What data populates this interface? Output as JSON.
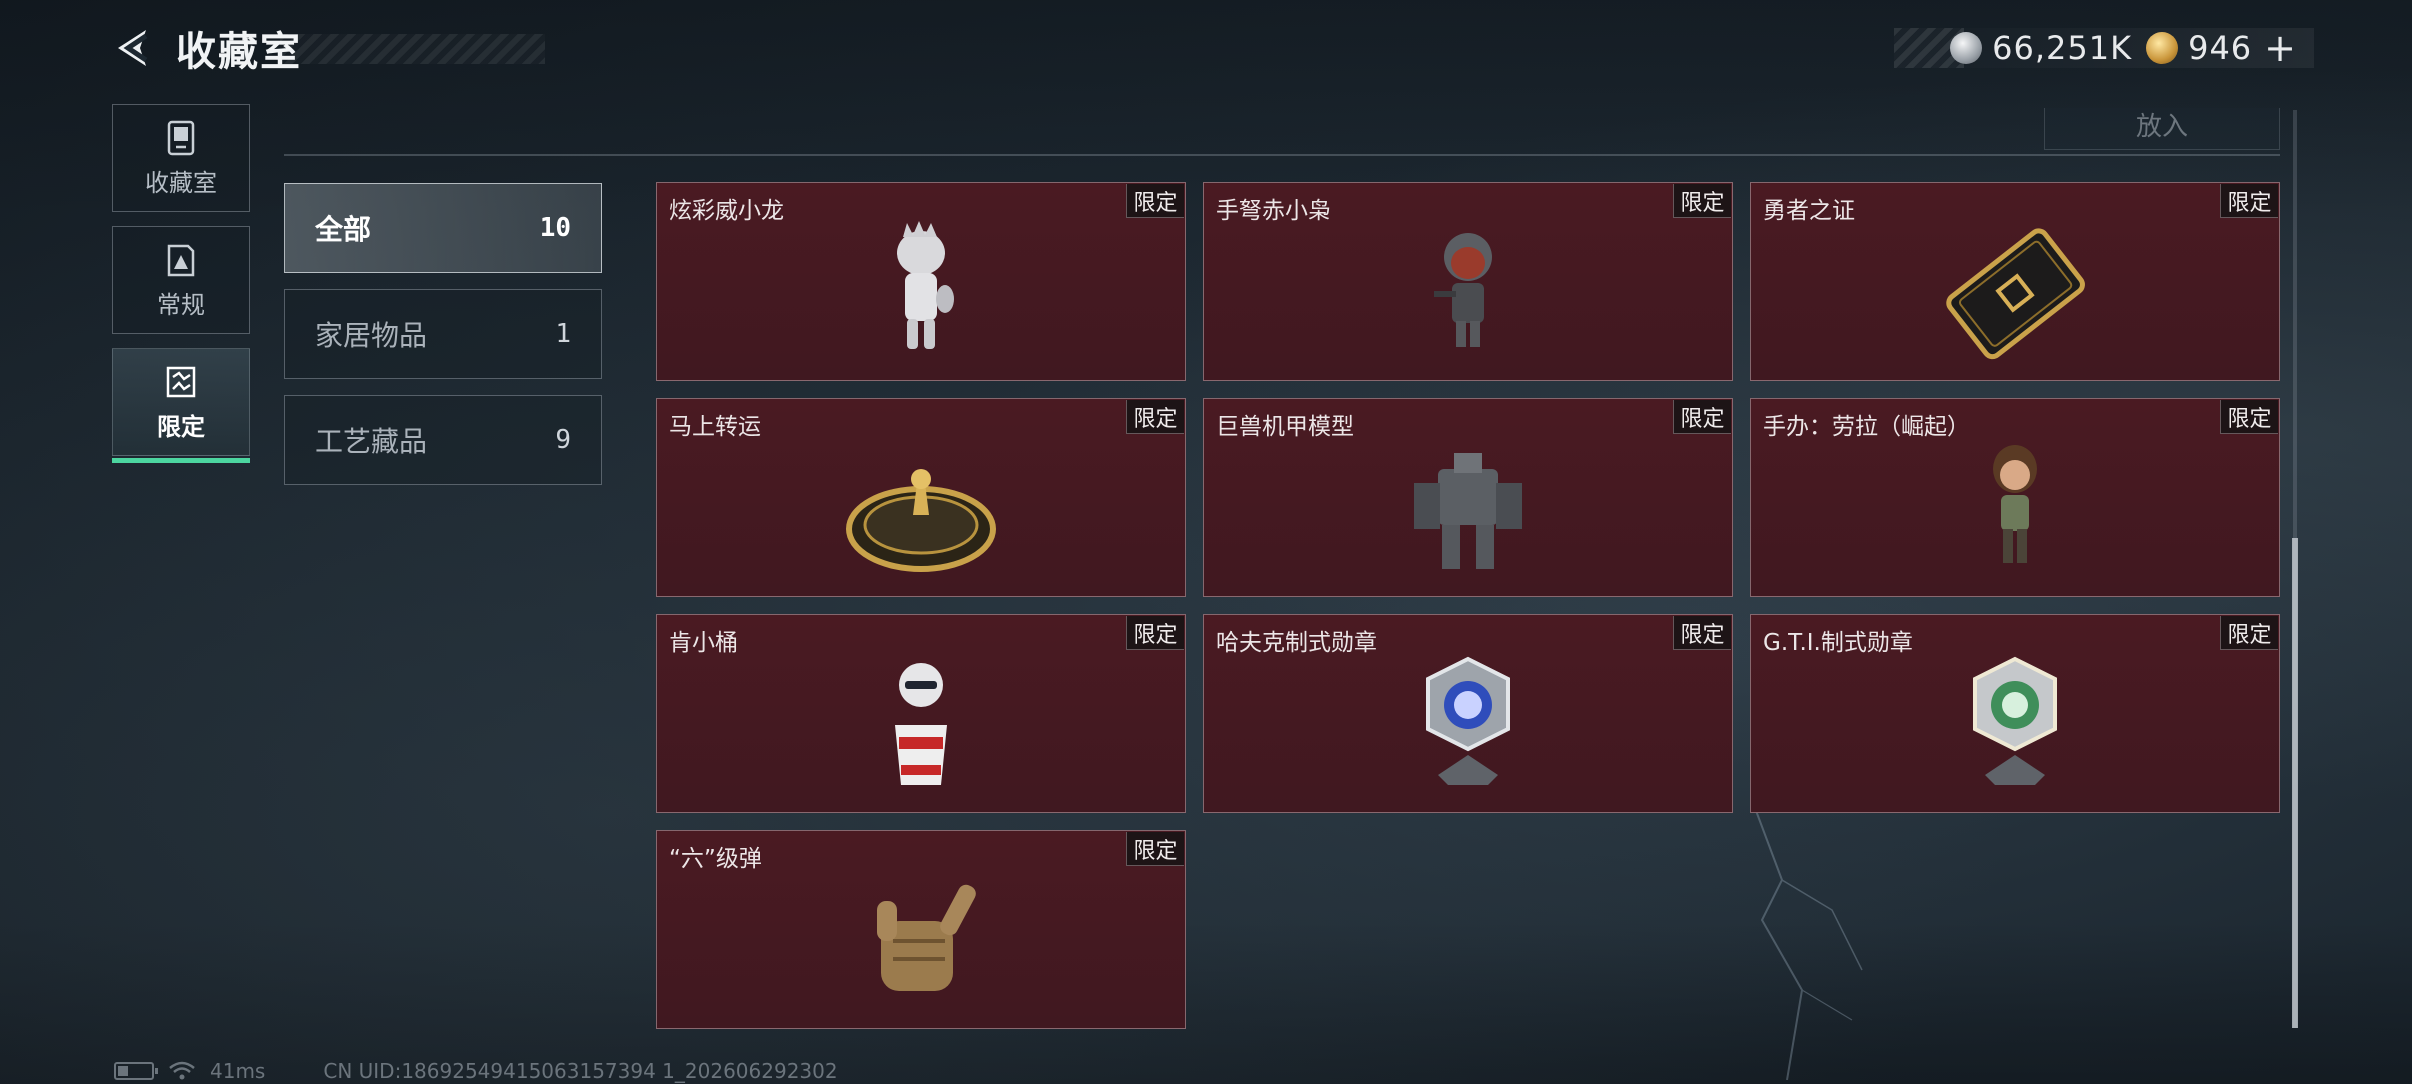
{
  "header": {
    "title": "收藏室"
  },
  "currency": {
    "silver_value": "66,251K",
    "gold_value": "946",
    "plus_label": "+"
  },
  "left_nav": [
    {
      "label": "收藏室",
      "icon": "collection-room-icon"
    },
    {
      "label": "常规",
      "icon": "regular-icon"
    },
    {
      "label": "限定",
      "icon": "limited-icon"
    }
  ],
  "put_button_label": "放入",
  "categories": [
    {
      "label": "全部",
      "count": "10"
    },
    {
      "label": "家居物品",
      "count": "1"
    },
    {
      "label": "工艺藏品",
      "count": "9"
    }
  ],
  "items": [
    {
      "name": "炫彩威小龙",
      "tag": "限定",
      "art": "figure-dragon-icon"
    },
    {
      "name": "手弩赤小枭",
      "tag": "限定",
      "art": "figure-crossbow-owl-icon"
    },
    {
      "name": "勇者之证",
      "tag": "限定",
      "art": "gold-card-icon"
    },
    {
      "name": "马上转运",
      "tag": "限定",
      "art": "golden-wheel-icon"
    },
    {
      "name": "巨兽机甲模型",
      "tag": "限定",
      "art": "mech-model-icon"
    },
    {
      "name": "手办：劳拉（崛起）",
      "tag": "限定",
      "art": "figure-lara-icon"
    },
    {
      "name": "肯小桶",
      "tag": "限定",
      "art": "figure-bucket-icon"
    },
    {
      "name": "哈夫克制式勋章",
      "tag": "限定",
      "art": "medal-blue-icon"
    },
    {
      "name": "G.T.I.制式勋章",
      "tag": "限定",
      "art": "medal-green-icon"
    },
    {
      "name": "“六”级弹",
      "tag": "限定",
      "art": "hand-gesture-icon"
    }
  ],
  "footer": {
    "ping": "41ms",
    "uid": "CN UID:18692549415063157394 1_202606292302"
  },
  "colors": {
    "card_bg": "#4a1a22",
    "accent_active": "#4cd6a0"
  }
}
